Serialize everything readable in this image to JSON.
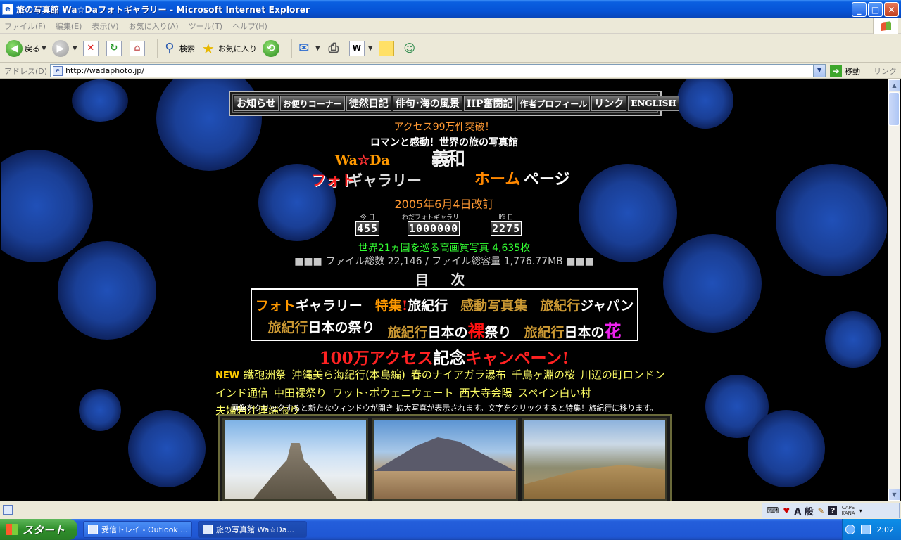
{
  "window": {
    "title": "旅の写真館 Wa☆Daフォトギャラリー - Microsoft Internet Explorer",
    "minimize": "_",
    "maximize": "□",
    "close": "✕"
  },
  "menu": [
    "ファイル(F)",
    "編集(E)",
    "表示(V)",
    "お気に入り(A)",
    "ツール(T)",
    "ヘルプ(H)"
  ],
  "toolbar": {
    "back_label": "戻る",
    "search_label": "検索",
    "favorites_label": "お気に入り"
  },
  "address": {
    "label": "アドレス(D)",
    "url": "http://wadaphoto.jp/",
    "go_label": "移動",
    "links_label": "リンク"
  },
  "page": {
    "nav": [
      "お知らせ",
      "お便りコーナー",
      "徒然日記",
      "俳句･海の風景",
      "HP奮闘記",
      "作者プロフィール",
      "リンク",
      "ENGLISH"
    ],
    "access": "アクセス99万件突破！",
    "subtitle": "ロマンと感動！世界の旅の写真館",
    "logo": {
      "wada": "Wa",
      "star": "☆",
      "da": "Da",
      "photo_red": "フォト",
      "photo_gray": "ギャラリー",
      "seal": "義和",
      "home_orange": "ホーム",
      "home_white": "ページ"
    },
    "revised": "2005年6月4日改訂",
    "counters": [
      {
        "label": "今 日",
        "value": "455"
      },
      {
        "label": "わだフォトギャラリー",
        "value": "1000000"
      },
      {
        "label": "昨 日",
        "value": "2275"
      }
    ],
    "world": "世界21ヵ国を巡る高画質写真 4,635枚",
    "files": "■■■ ファイル総数 22,146 / ファイル総容量 1,776.77MB ■■■",
    "toc": "目 次",
    "categories": {
      "photo_orange": "フォト",
      "photo_white": "ギャラリー",
      "special_orange": "特集",
      "special_red": "!",
      "special_white": "旅紀行",
      "kando": "感動写真集",
      "japan_gold": "旅紀行",
      "japan_white": "ジャパン",
      "matsuri_gold": "旅紀行",
      "matsuri_white": "日本の祭り",
      "hadaka_gold": "旅紀行",
      "hadaka_white1": "日本の",
      "hadaka_red": "裸",
      "hadaka_white2": "祭り",
      "hana_gold": "旅紀行",
      "hana_white": "日本の",
      "hana_mag": "花"
    },
    "campaign": {
      "c1": "100万アクセス",
      "c2": "記念",
      "c3": "キャンペーン!"
    },
    "news_tag": "NEW",
    "news_row1": [
      "鐵砲洲祭",
      "沖縄美ら海紀行(本島編)",
      "春のナイアガラ瀑布",
      "千鳥ヶ淵の桜",
      "川辺の町ロンドン"
    ],
    "news_row2": [
      "インド通信",
      "中田裸祭り",
      "ワット･ポウェニウェート",
      "西大寺会陽",
      "スペイン白い村",
      "夫婦岩注連縄張り"
    ],
    "note": "画像をクリックすると新たなウィンドウが開き 拡大写真が表示されます。文字をクリックすると特集！旅紀行に移ります。"
  },
  "status": {
    "ime_mode": "A 般",
    "caps": "CAPS",
    "kana": "KANA"
  },
  "taskbar": {
    "start": "スタート",
    "tasks": [
      "受信トレイ - Outlook ...",
      "旅の写真館 Wa☆Da..."
    ],
    "clock": "2:02"
  }
}
